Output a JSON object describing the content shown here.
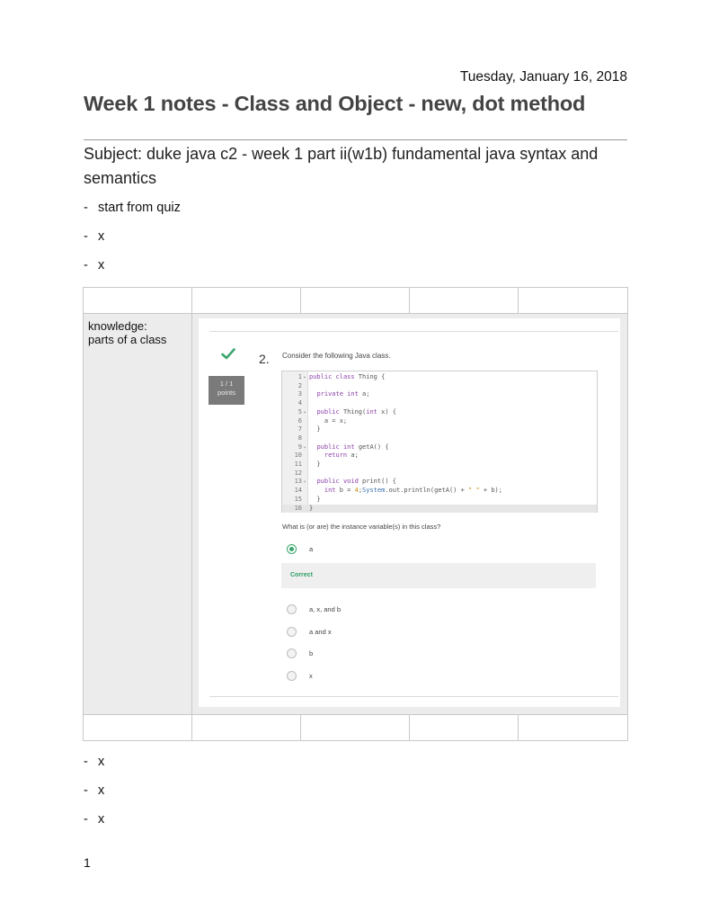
{
  "date": "Tuesday, January 16, 2018",
  "title": "Week 1 notes - Class and Object - new, dot method",
  "subject": "Subject: duke java c2 - week 1 part ii(w1b) fundamental java syntax and semantics",
  "bullets_top": [
    "start from quiz",
    "x",
    "x"
  ],
  "bullet_dash": "-",
  "knowledge": {
    "line1": "knowledge:",
    "line2": "parts of a class"
  },
  "quiz": {
    "question_number": "2.",
    "points": {
      "line1": "1 / 1",
      "line2": "points"
    },
    "prompt": "Consider the following Java class.",
    "answer_prompt": "What is (or are) the instance variable(s) in this class?",
    "options": [
      "a",
      "a, x, and b",
      "a and x",
      "b",
      "x"
    ],
    "selected": "a",
    "feedback": "Correct",
    "code": {
      "line_numbers": [
        "1",
        "2",
        "3",
        "4",
        "5",
        "6",
        "7",
        "8",
        "9",
        "10",
        "11",
        "12",
        "13",
        "14",
        "15",
        "16"
      ],
      "fold_marker": "▾",
      "tokens": {
        "public": "public",
        "class": "class",
        "private": "private",
        "int": "int",
        "void": "void",
        "return": "return",
        "four": "4",
        "system": "System",
        "quote_space": "\" \"",
        "line1_rest": " Thing {",
        "line3_rest": " a;",
        "line5_rest": " Thing(",
        "line5_end": " x) {",
        "line6": "    a = x;",
        "close_inner": "  }",
        "line9_rest": " getA() {",
        "line10_rest": " a;",
        "line13_rest": " print() {",
        "line14_mid": " b = ",
        "line14_sys_pre": ";",
        "line14_sys_post": ".out.println(getA() + ",
        "line14_end": " + b);",
        "close_outer": "}"
      }
    }
  },
  "bullets_bottom": [
    "x",
    "x",
    "x"
  ],
  "page_number": "1",
  "colors": {
    "accent_green": "#3aa76d",
    "title_gray": "#444444"
  },
  "icons": [
    "checkmark-icon",
    "radio-selected-icon",
    "radio-empty-icon"
  ]
}
